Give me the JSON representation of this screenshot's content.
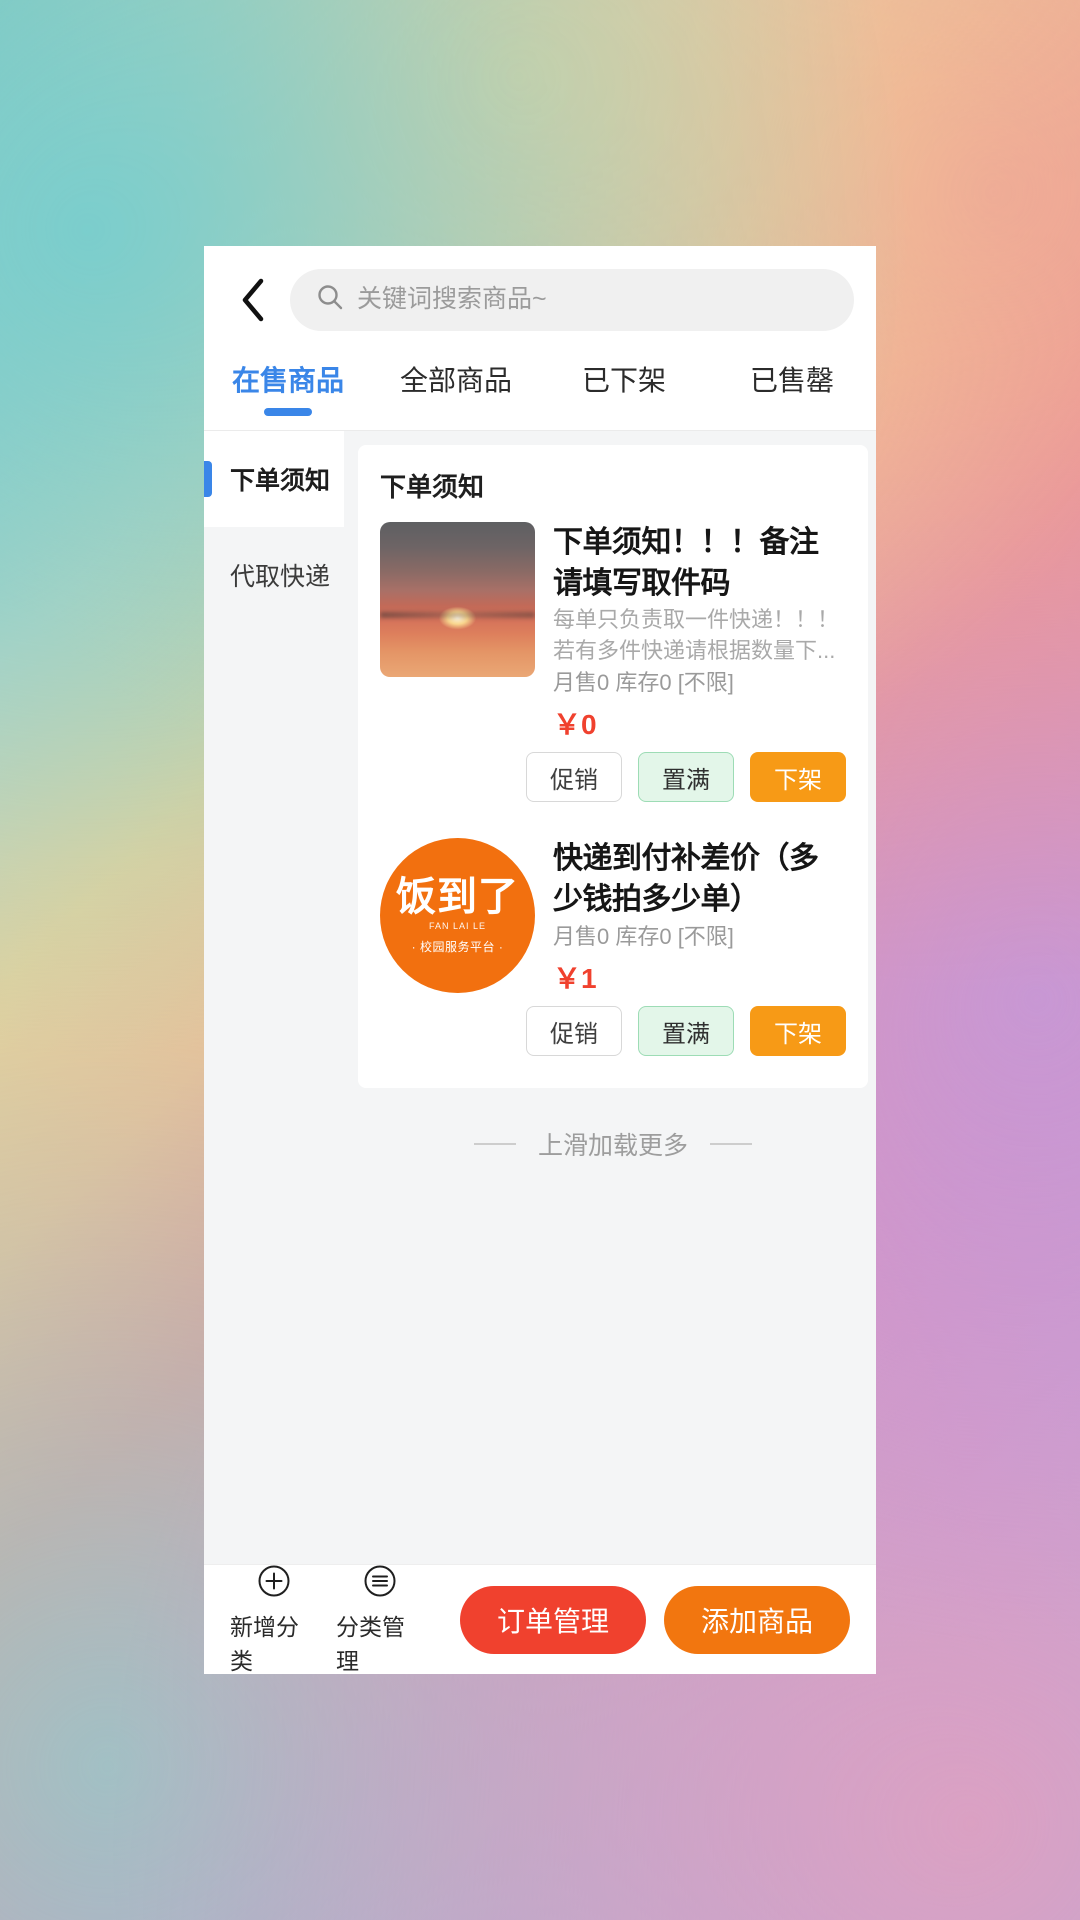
{
  "header": {
    "back_icon": "chevron-left-icon",
    "search": {
      "icon": "search-icon",
      "placeholder": "关键词搜索商品~",
      "value": ""
    }
  },
  "tabs": [
    {
      "label": "在售商品",
      "active": true
    },
    {
      "label": "全部商品",
      "active": false
    },
    {
      "label": "已下架",
      "active": false
    },
    {
      "label": "已售罄",
      "active": false
    }
  ],
  "sidebar": {
    "items": [
      {
        "label": "下单须知",
        "active": true
      },
      {
        "label": "代取快递",
        "active": false
      }
    ]
  },
  "main": {
    "group_title": "下单须知",
    "products": [
      {
        "image": "sunset-photo",
        "title": "下单须知！！！备注请填写取件码",
        "desc_line1": "每单只负责取一件快递！！！",
        "desc_line2": "若有多件快递请根据数量下...",
        "stats": "月售0 库存0 [不限]",
        "price": "￥0",
        "actions": {
          "promo": "促销",
          "full": "置满",
          "offshelf": "下架"
        }
      },
      {
        "image": "fandaole-logo",
        "logo": {
          "main": "饭到了",
          "pinyin": "FAN LAI LE",
          "sub": "· 校园服务平台 ·"
        },
        "title": "快递到付补差价（多少钱拍多少单）",
        "desc_line1": "",
        "desc_line2": "",
        "stats": "月售0 库存0 [不限]",
        "price": "￥1",
        "actions": {
          "promo": "促销",
          "full": "置满",
          "offshelf": "下架"
        }
      }
    ],
    "load_more": "上滑加载更多"
  },
  "footer": {
    "add_category": {
      "icon": "plus-circle-icon",
      "label": "新增分类"
    },
    "manage_category": {
      "icon": "list-circle-icon",
      "label": "分类管理"
    },
    "order_manage": {
      "label": "订单管理"
    },
    "add_product": {
      "label": "添加商品"
    }
  },
  "colors": {
    "accent_blue": "#3a86e8",
    "price_red": "#f0412e",
    "orange": "#f2760f",
    "offshelf_orange": "#f79a16",
    "full_green_bg": "#e3f6e9"
  }
}
